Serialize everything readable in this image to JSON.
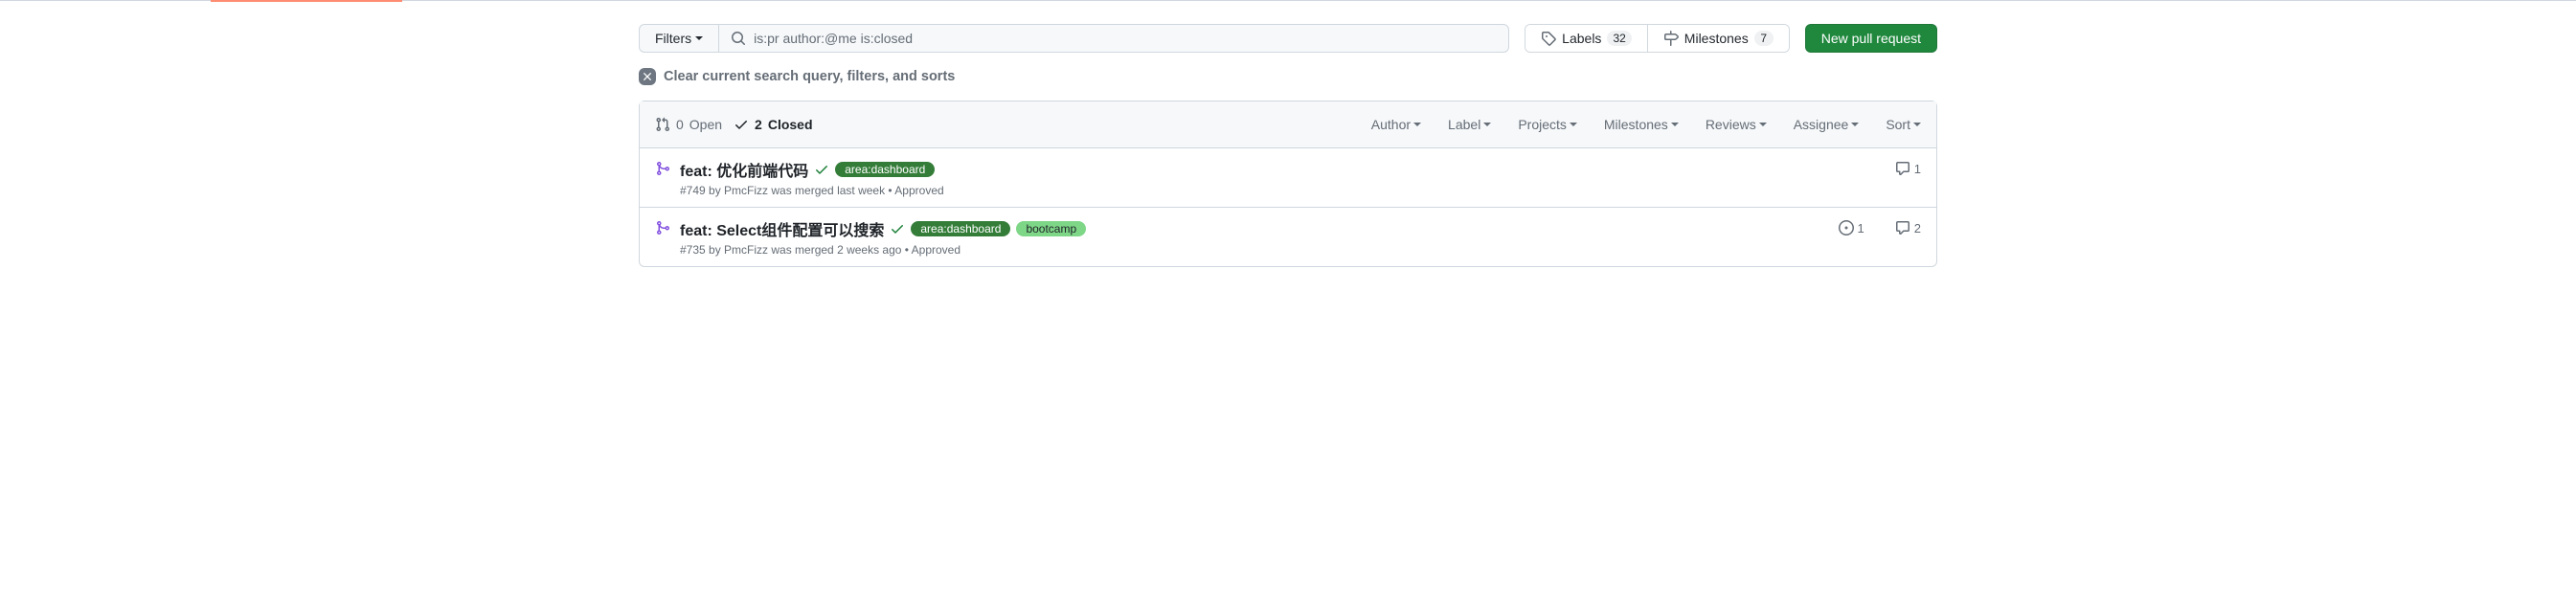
{
  "filters": {
    "button_label": "Filters",
    "search_value": "is:pr author:@me is:closed"
  },
  "pills": {
    "labels_text": "Labels",
    "labels_count": "32",
    "milestones_text": "Milestones",
    "milestones_count": "7"
  },
  "primary_button": "New pull request",
  "clear_text": "Clear current search query, filters, and sorts",
  "states": {
    "open_count": "0",
    "open_label": "Open",
    "closed_count": "2",
    "closed_label": "Closed"
  },
  "filter_menus": [
    "Author",
    "Label",
    "Projects",
    "Milestones",
    "Reviews",
    "Assignee",
    "Sort"
  ],
  "items": [
    {
      "title": "feat: 优化前端代码",
      "labels": [
        {
          "text": "area:dashboard",
          "cls": "label-dashboard"
        }
      ],
      "meta": "#749 by PmcFizz was merged last week • Approved",
      "linked_issues": "",
      "comments": "1"
    },
    {
      "title": "feat: Select组件配置可以搜索",
      "labels": [
        {
          "text": "area:dashboard",
          "cls": "label-dashboard"
        },
        {
          "text": "bootcamp",
          "cls": "label-bootcamp"
        }
      ],
      "meta": "#735 by PmcFizz was merged 2 weeks ago • Approved",
      "linked_issues": "1",
      "comments": "2"
    }
  ]
}
